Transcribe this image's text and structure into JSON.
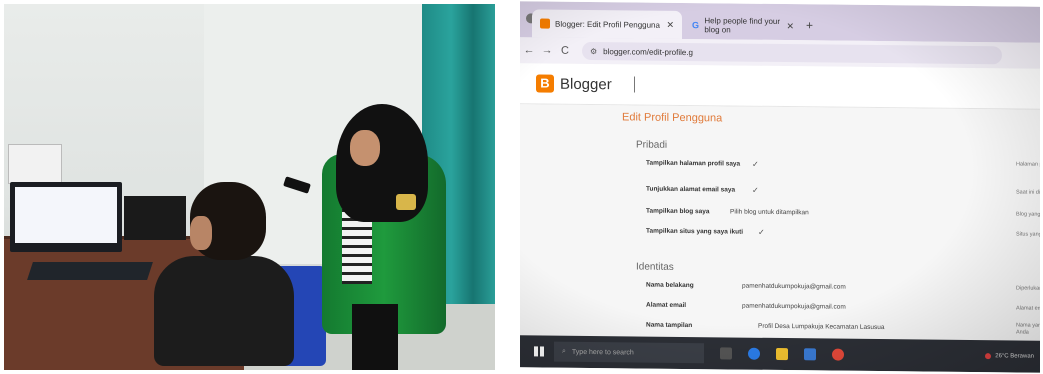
{
  "browser": {
    "tabs": [
      {
        "title": "Blogger: Edit Profil Pengguna",
        "close": "✕"
      },
      {
        "title": "Help people find your blog on",
        "close": "✕"
      }
    ],
    "new_tab": "+",
    "url": "blogger.com/edit-profile.g",
    "nav": {
      "back": "←",
      "forward": "→",
      "reload": "C"
    }
  },
  "blogger": {
    "logo_letter": "B",
    "brand": "Blogger",
    "page_title": "Edit Profil Pengguna",
    "sections": {
      "pribadi": "Pribadi",
      "identitas": "Identitas"
    },
    "pribadi_rows": [
      {
        "label": "Tampilkan halaman profil saya",
        "check": "✓",
        "desc": "Halaman profil Anda tidak akan dapat diakses jika dicentang"
      },
      {
        "label": "Tunjukkan alamat email saya",
        "check": "✓",
        "desc": "Saat ini ditentukan pamenhatdukumpokuja@gmail"
      },
      {
        "label": "Tampilkan blog saya",
        "value": "Pilih blog untuk ditampilkan",
        "desc": "Blog yang akan muncul di profil Anda"
      },
      {
        "label": "Tampilkan situs yang saya ikuti",
        "check": "✓",
        "desc": "Situs yang Anda ikuti akan muncul di profil Anda"
      }
    ],
    "identitas_rows": [
      {
        "label": "Nama belakang",
        "value": "pamenhatdukumpokuja@gmail.com",
        "desc": "Diperlukan"
      },
      {
        "label": "Alamat email",
        "value": "pamenhatdukumpokuja@gmail.com",
        "desc": "Alamat email tidak pernah untuk menghubungi Anda"
      },
      {
        "label": "Nama tampilan",
        "value": "Profil Desa Lumpakuja Kecamatan Lasusua",
        "desc": "Nama yang digunakan untuk menandatangani postingan Anda"
      }
    ]
  },
  "taskbar": {
    "search_placeholder": "Type here to search",
    "weather": "26°C Berawan"
  },
  "colors": {
    "blogger_orange": "#f57d00",
    "title_orange": "#e07a3a",
    "jacket_green": "#1f9a3d",
    "curtain_teal": "#2aa39d",
    "chair_blue": "#2446b5"
  }
}
